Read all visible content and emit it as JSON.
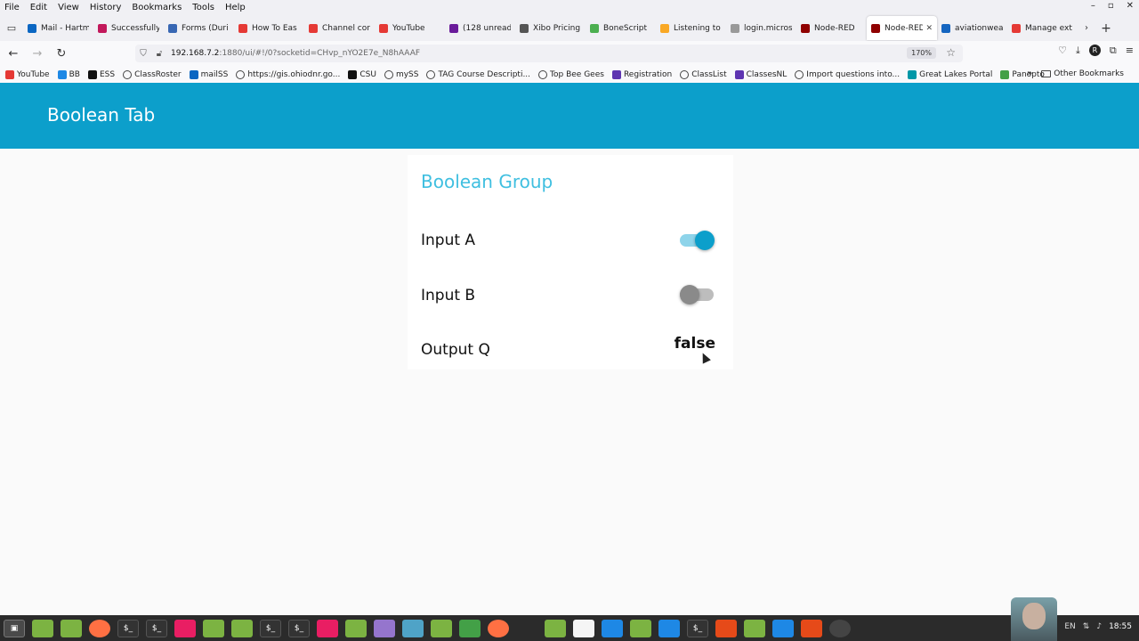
{
  "browser": {
    "menu": [
      "File",
      "Edit",
      "View",
      "History",
      "Bookmarks",
      "Tools",
      "Help"
    ],
    "tabs": [
      {
        "title": "Mail - Hartm",
        "color": "#0a66c2",
        "active": false
      },
      {
        "title": "Successfully",
        "color": "#c2185b",
        "active": false
      },
      {
        "title": "Forms (Duri",
        "color": "#3867b3",
        "active": false
      },
      {
        "title": "How To Eas",
        "color": "#e53935",
        "active": false
      },
      {
        "title": "Channel cor",
        "color": "#e53935",
        "active": false
      },
      {
        "title": "YouTube",
        "color": "#e53935",
        "active": false
      },
      {
        "title": "(128 unread",
        "color": "#6a1b9a",
        "active": false
      },
      {
        "title": "Xibo Pricing",
        "color": "#555555",
        "active": false
      },
      {
        "title": "BoneScript",
        "color": "#4caf50",
        "active": false
      },
      {
        "title": "Listening to",
        "color": "#f9a825",
        "active": false
      },
      {
        "title": "login.microsoft",
        "color": "#999999",
        "active": false
      },
      {
        "title": "Node-RED",
        "color": "#8f0000",
        "active": false
      },
      {
        "title": "Node-RED",
        "color": "#8f0000",
        "active": true
      },
      {
        "title": "aviationwea",
        "color": "#1565c0",
        "active": false
      },
      {
        "title": "Manage ext",
        "color": "#e53935",
        "active": false
      }
    ],
    "url_host": "192.168.7.2",
    "url_rest": ":1880/ui/#!/0?socketid=CHvp_nYO2E7e_N8hAAAF",
    "zoom": "170%",
    "bookmarks": [
      {
        "label": "YouTube",
        "color": "#e53935"
      },
      {
        "label": "BB",
        "color": "#1e88e5"
      },
      {
        "label": "ESS",
        "color": "#111111"
      },
      {
        "label": "ClassRoster",
        "color": ""
      },
      {
        "label": "mailSS",
        "color": "#0a66c2"
      },
      {
        "label": "https://gis.ohiodnr.go...",
        "color": ""
      },
      {
        "label": "CSU",
        "color": "#111111"
      },
      {
        "label": "mySS",
        "color": ""
      },
      {
        "label": "TAG Course Descripti...",
        "color": ""
      },
      {
        "label": "Top Bee Gees",
        "color": ""
      },
      {
        "label": "Registration",
        "color": "#5e35b1"
      },
      {
        "label": "ClassList",
        "color": ""
      },
      {
        "label": "ClassesNL",
        "color": "#5e35b1"
      },
      {
        "label": "Import questions into...",
        "color": ""
      },
      {
        "label": "Great Lakes Portal",
        "color": "#0097a7"
      },
      {
        "label": "Panopto",
        "color": "#43a047"
      }
    ],
    "other_bookmarks": "Other Bookmarks"
  },
  "dashboard": {
    "header_title": "Boolean Tab",
    "group_title": "Boolean Group",
    "header_color": "#0c9fcb",
    "group_title_color": "#3fbfe0",
    "input_a": {
      "label": "Input A",
      "state": true
    },
    "input_b": {
      "label": "Input B",
      "state": false
    },
    "output_q": {
      "label": "Output Q",
      "value": "false"
    }
  },
  "taskbar": {
    "language": "EN",
    "clock": "18:55"
  }
}
